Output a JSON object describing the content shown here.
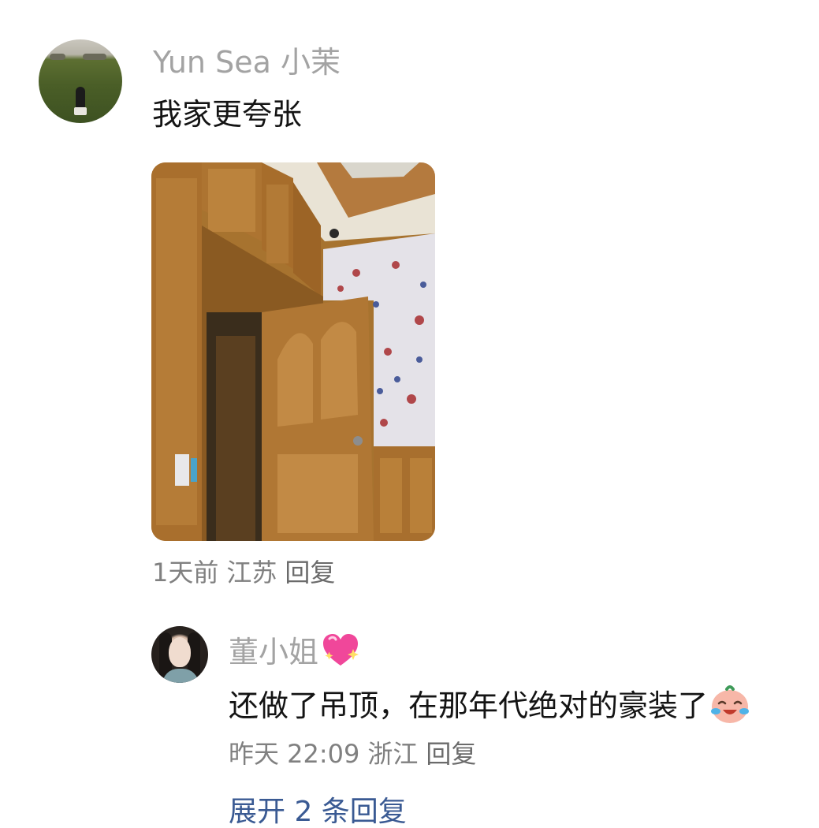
{
  "comment": {
    "username": "Yun Sea 小茉",
    "text": "我家更夸张",
    "time": "1天前",
    "location": "江苏",
    "reply_label": "回复",
    "photo_icon": "room-photo"
  },
  "reply": {
    "username": "董小姐",
    "badge_icon": "sparkling-heart-icon",
    "text": "还做了吊顶，在那年代绝对的豪装了",
    "emoji_icon": "crying-laughing-face-icon",
    "time": "昨天 22:09",
    "location": "浙江",
    "reply_label": "回复"
  },
  "expand_label": "展开 2 条回复",
  "colors": {
    "username": "#a3a3a3",
    "text": "#141414",
    "meta": "#808080",
    "link": "#3a5a93"
  }
}
